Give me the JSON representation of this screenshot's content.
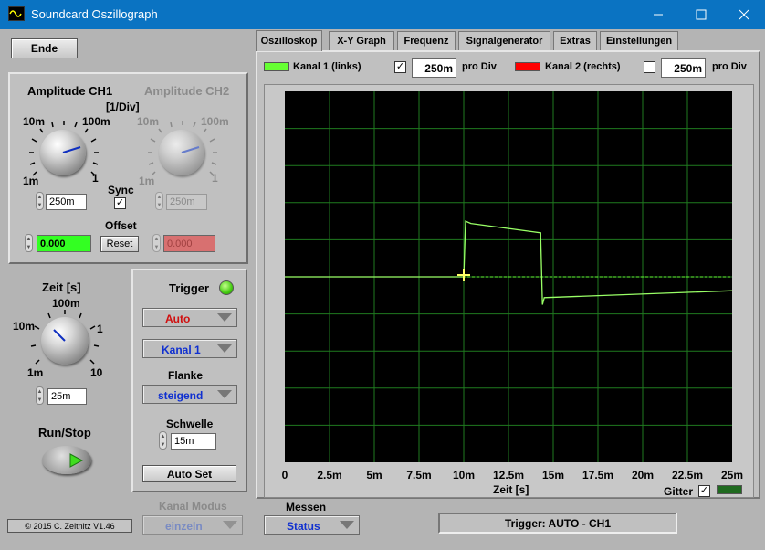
{
  "window": {
    "title": "Soundcard Oszillograph"
  },
  "left": {
    "ende_label": "Ende",
    "amp_ch1": "Amplitude CH1",
    "amp_ch2": "Amplitude CH2",
    "per_div": "[1/Div]",
    "knob_labels": {
      "10m": "10m",
      "100m": "100m",
      "1m": "1m",
      "1": "1"
    },
    "ch1_value": "250m",
    "ch2_value": "250m",
    "sync_label": "Sync",
    "offset_label": "Offset",
    "offset_ch1": "0.000",
    "offset_ch2": "0.000",
    "reset_label": "Reset",
    "zeit_label": "Zeit [s]",
    "zeit_knob": {
      "100m": "100m",
      "10m": "10m",
      "1": "1",
      "1m": "1m",
      "10": "10"
    },
    "zeit_value": "25m",
    "runstop_label": "Run/Stop",
    "copyright": "© 2015  C. Zeitnitz V1.46",
    "kanal_modus_label": "Kanal Modus",
    "kanal_modus_value": "einzeln"
  },
  "trigger": {
    "title": "Trigger",
    "mode": "Auto",
    "channel": "Kanal 1",
    "flanke_label": "Flanke",
    "flanke": "steigend",
    "schwelle_label": "Schwelle",
    "schwelle": "15m",
    "autoset": "Auto Set"
  },
  "tabs": [
    "Oszilloskop",
    "X-Y Graph",
    "Frequenz",
    "Signalgenerator",
    "Extras",
    "Einstellungen"
  ],
  "channels": {
    "ch1_label": "Kanal 1 (links)",
    "ch1_div": "250m",
    "pro_div": "pro Div",
    "ch2_label": "Kanal 2 (rechts)",
    "ch2_div": "250m",
    "ch1_color": "#66ff33",
    "ch2_color": "#ff0000"
  },
  "chart_data": {
    "type": "line",
    "xlabel": "Zeit [s]",
    "x_ticks": [
      "0",
      "2.5m",
      "5m",
      "7.5m",
      "10m",
      "12.5m",
      "15m",
      "17.5m",
      "20m",
      "22.5m",
      "25m"
    ],
    "xlim": [
      0,
      0.025
    ],
    "ylim": [
      -4,
      4
    ],
    "grid": true,
    "series": [
      {
        "values": [
          [
            0,
            0
          ],
          [
            0.01,
            0
          ],
          [
            0.0101,
            1.2
          ],
          [
            0.0104,
            1.15
          ],
          [
            0.0143,
            0.95
          ],
          [
            0.0143,
            0.85
          ],
          [
            0.0144,
            -0.6
          ],
          [
            0.0145,
            -0.45
          ],
          [
            0.025,
            -0.3
          ]
        ]
      }
    ]
  },
  "bottom": {
    "gitter_label": "Gitter",
    "messen_label": "Messen",
    "messen_value": "Status",
    "trigger_status": "Trigger: AUTO - CH1"
  }
}
